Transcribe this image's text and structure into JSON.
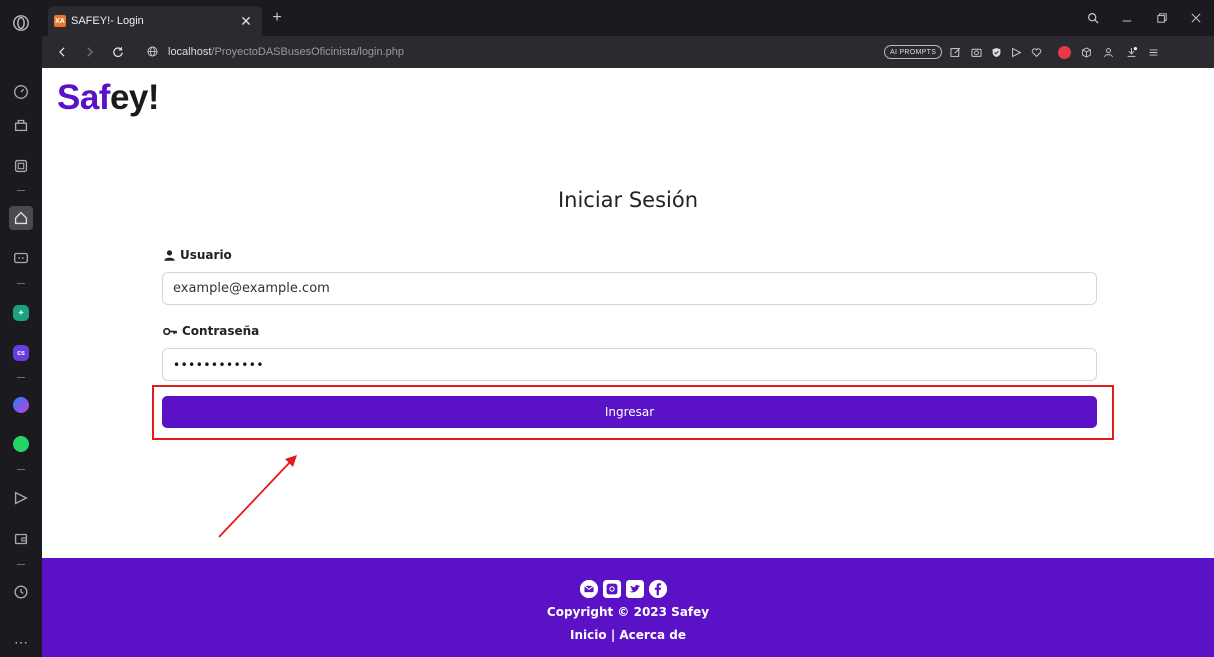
{
  "browser": {
    "tab_title": "SAFEY!- Login",
    "tab_favicon": "XA",
    "new_tab_symbol": "+",
    "url_host": "localhost",
    "url_path": "/ProyectoDASBusesOficinista/login.php",
    "ai_prompts_label": "AI PROMPTS",
    "sidebar_app_cs": "cs"
  },
  "page": {
    "brand_accent": "Saf",
    "brand_rest": "ey!",
    "title": "Iniciar Sesión",
    "username": {
      "label": "Usuario",
      "value": "example@example.com"
    },
    "password": {
      "label": "Contraseña",
      "value": "••••••••••••"
    },
    "submit_label": "Ingresar",
    "footer": {
      "copyright": "Copyright © 2023 Safey",
      "link_home": "Inicio",
      "separator": "|",
      "link_about": "Acerca de"
    }
  },
  "colors": {
    "brand_purple": "#5b12c7",
    "annotation_red": "#e31b1b"
  }
}
